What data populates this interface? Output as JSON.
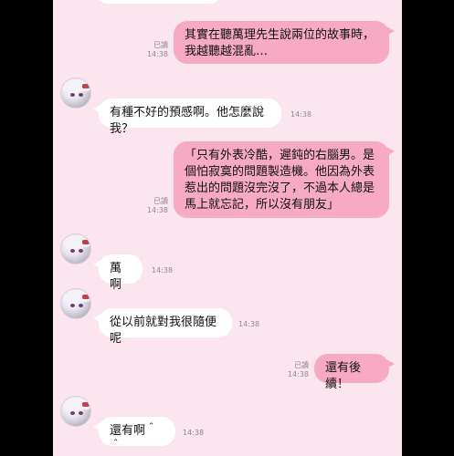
{
  "messages": [
    {
      "side": "out",
      "text": "其實在聽萬理先生說兩位的故事時，我越聽越混亂…",
      "read": "已讀",
      "time": "14:38"
    },
    {
      "side": "in",
      "text": "有種不好的預感啊。他怎麼說我？",
      "time": "14:38"
    },
    {
      "side": "out",
      "text": "「只有外表冷酷，遲鈍的右腦男。是個怕寂寞的問題製造機。他因為外表惹出的問題沒完沒了，不過本人總是馬上就忘記，所以沒有朋友」",
      "read": "已讀",
      "time": "14:38"
    },
    {
      "side": "in",
      "text": "萬啊",
      "time": "14:38"
    },
    {
      "side": "in",
      "text": "從以前就對我很隨便呢",
      "time": "14:38"
    },
    {
      "side": "out",
      "text": "還有後續！",
      "read": "已讀",
      "time": "14:38"
    },
    {
      "side": "in",
      "text": "還有啊＾＾",
      "time": "14:38"
    }
  ],
  "colors": {
    "background": "#fbe5ee",
    "outgoing_bubble": "#f7aac3",
    "incoming_bubble": "#ffffff"
  },
  "icons": {
    "avatar": "white-haired-character-avatar"
  }
}
